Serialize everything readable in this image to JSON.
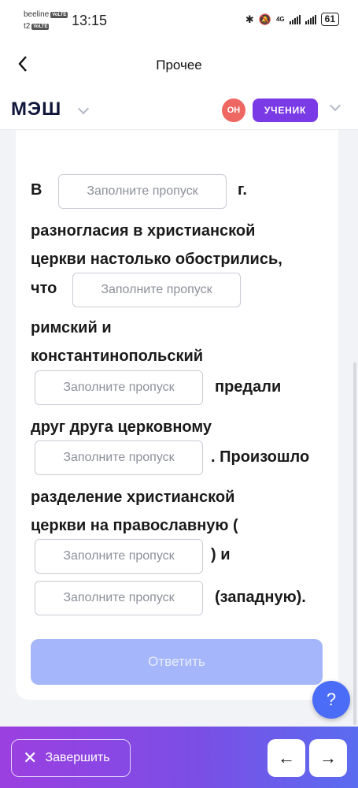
{
  "status_bar": {
    "carrier1": "beeline",
    "carrier2": "t2",
    "volte": "VoLTE",
    "time": "13:15",
    "net": "4G",
    "battery": "61"
  },
  "header": {
    "title": "Прочее"
  },
  "app": {
    "logo": "МЭШ",
    "online_badge": "ОН",
    "role": "УЧЕНИК"
  },
  "exercise": {
    "placeholder": "Заполните пропуск",
    "segments": [
      "В",
      "г.",
      "разногласия в христианской",
      "церкви настолько обострились,",
      "что",
      "римский и",
      "константинопольский",
      "предали",
      "друг друга церковному",
      ". Произошло",
      "разделение христианской",
      "церкви на православную (",
      ") и",
      "(западную)."
    ]
  },
  "submit_label": "Ответить",
  "help_label": "?",
  "bottom_bar": {
    "finish_label": "Завершить",
    "prev_icon": "←",
    "next_icon": "→"
  }
}
